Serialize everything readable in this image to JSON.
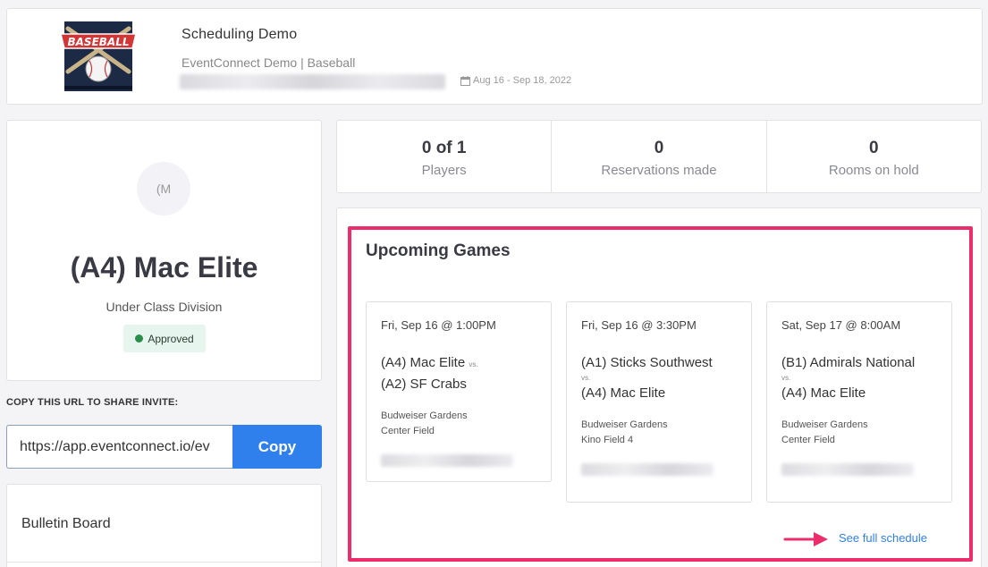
{
  "header": {
    "logo_text": "BASEBALL",
    "event_title": "Scheduling Demo",
    "event_subtitle": "EventConnect Demo | Baseball",
    "date_range": "Aug 16 - Sep 18, 2022",
    "icons": {
      "date": "calendar-icon"
    }
  },
  "team": {
    "avatar_initials": "(M",
    "name": "(A4) Mac Elite",
    "division": "Under Class Division",
    "status": "Approved",
    "status_color": "#2c8c4a"
  },
  "share": {
    "label": "COPY THIS URL TO SHARE INVITE:",
    "url": "https://app.eventconnect.io/ev",
    "copy_label": "Copy"
  },
  "bulletin": {
    "title": "Bulletin Board"
  },
  "stats": [
    {
      "value": "0 of 1",
      "label": "Players"
    },
    {
      "value": "0",
      "label": "Reservations made"
    },
    {
      "value": "0",
      "label": "Rooms on hold"
    }
  ],
  "games": {
    "title": "Upcoming Games",
    "vs_label": "vs.",
    "items": [
      {
        "date": "Fri, Sep 16 @ 1:00PM",
        "team1": "(A4) Mac Elite",
        "team2": "(A2) SF Crabs",
        "venue": "Budweiser Gardens",
        "field": "Center Field"
      },
      {
        "date": "Fri, Sep 16 @ 3:30PM",
        "team1": "(A1) Sticks Southwest",
        "team2": "(A4) Mac Elite",
        "venue": "Budweiser Gardens",
        "field": "Kino Field 4"
      },
      {
        "date": "Sat, Sep 17 @ 8:00AM",
        "team1": "(B1) Admirals National",
        "team2": "(A4) Mac Elite",
        "venue": "Budweiser Gardens",
        "field": "Center Field"
      }
    ],
    "see_schedule_label": "See full schedule"
  },
  "colors": {
    "accent": "#2f80ec",
    "highlight": "#ec2d6c",
    "approved_bg": "#e6f6ee"
  }
}
